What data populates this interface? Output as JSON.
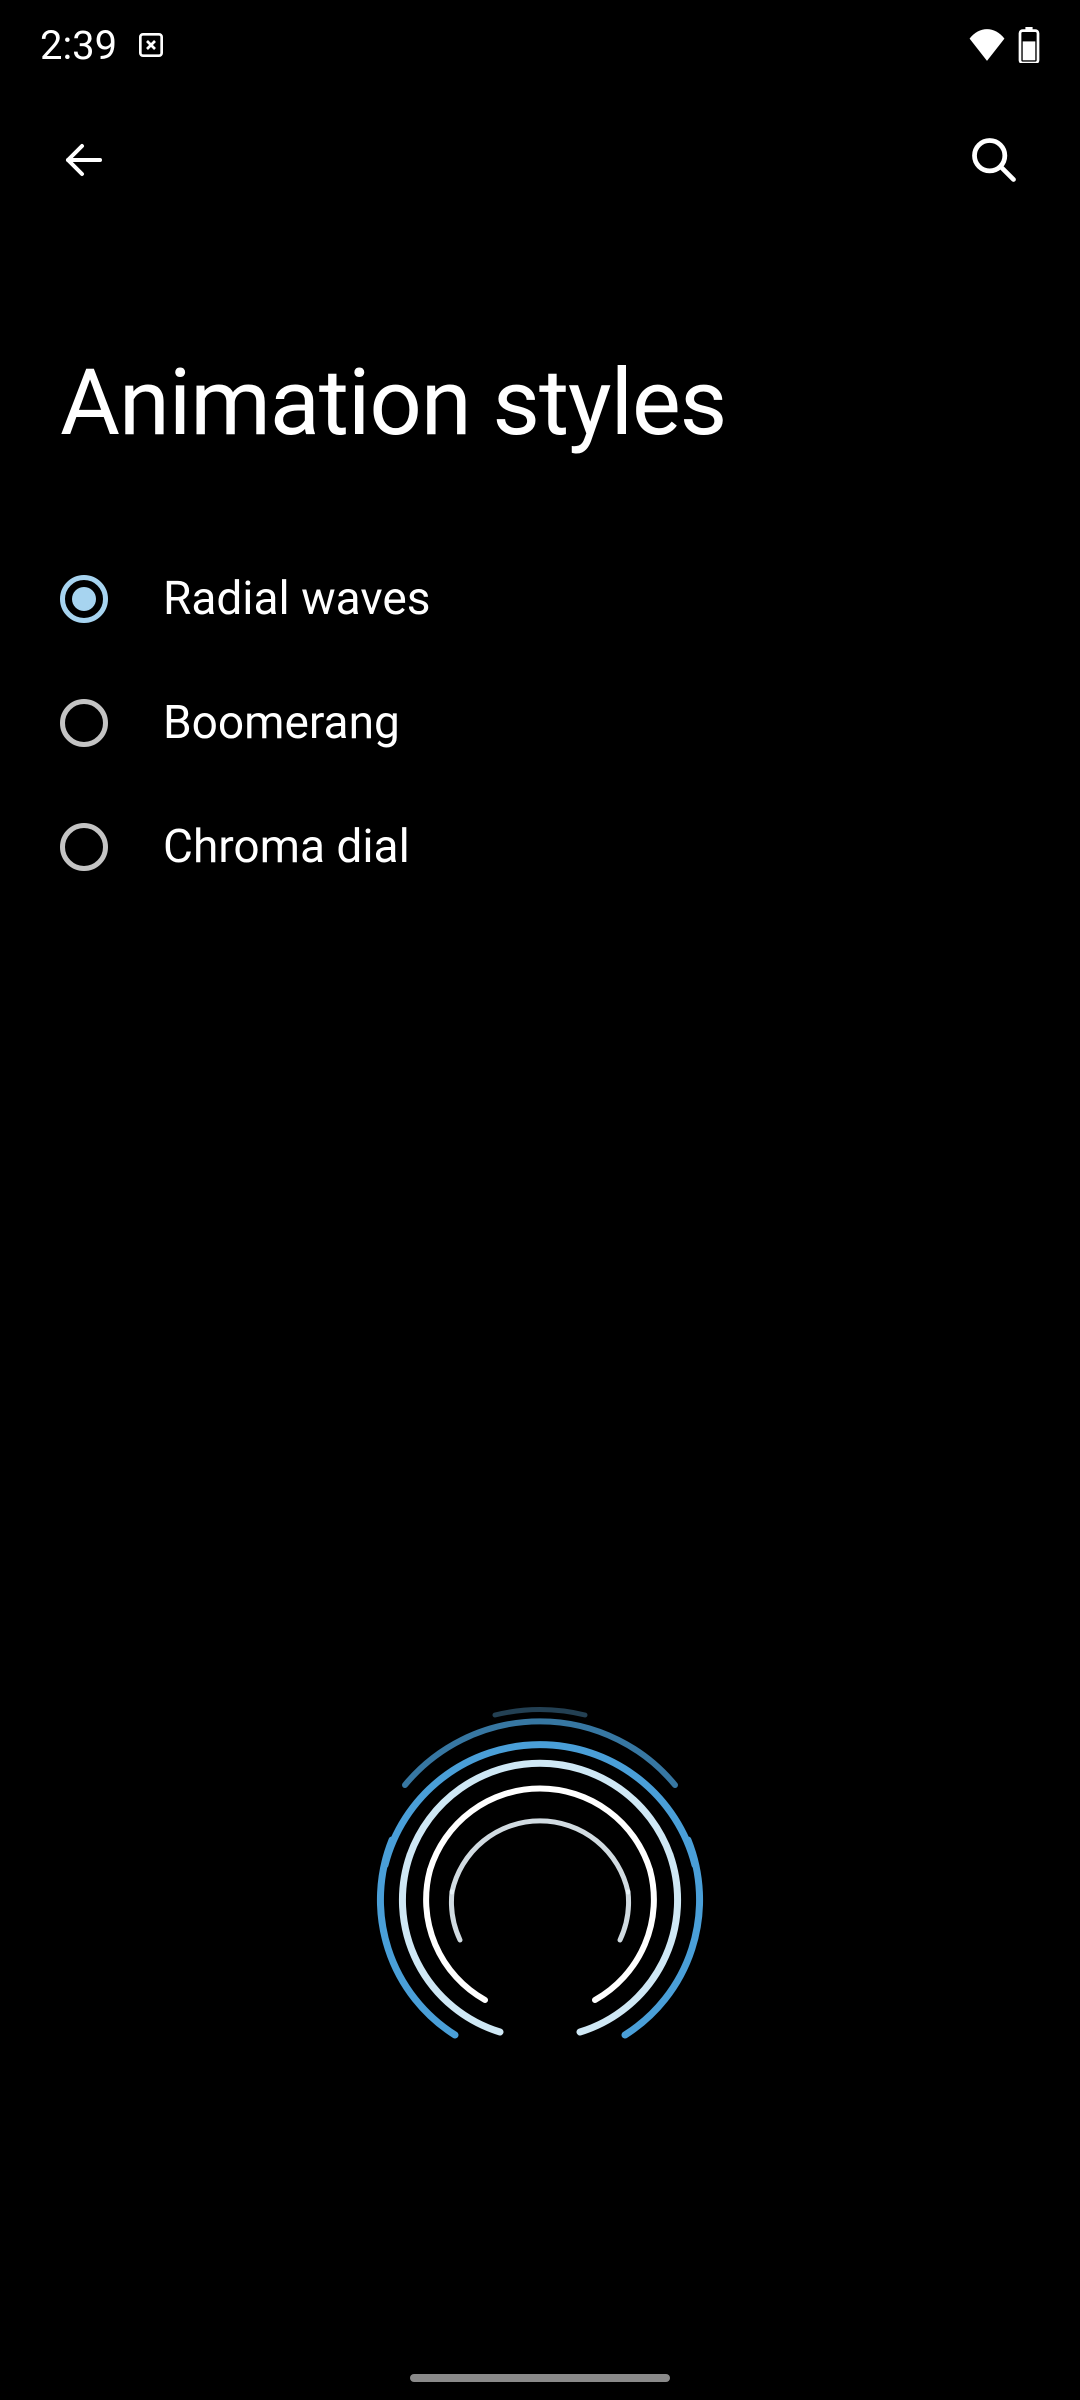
{
  "status_bar": {
    "time": "2:39"
  },
  "header": {
    "title": "Animation styles"
  },
  "options": [
    {
      "label": "Radial waves",
      "selected": true
    },
    {
      "label": "Boomerang",
      "selected": false
    },
    {
      "label": "Chroma dial",
      "selected": false
    }
  ],
  "colors": {
    "accent": "#a7d4f0",
    "preview_blue": "#4a9fd8",
    "preview_light": "#cfe8f5"
  }
}
